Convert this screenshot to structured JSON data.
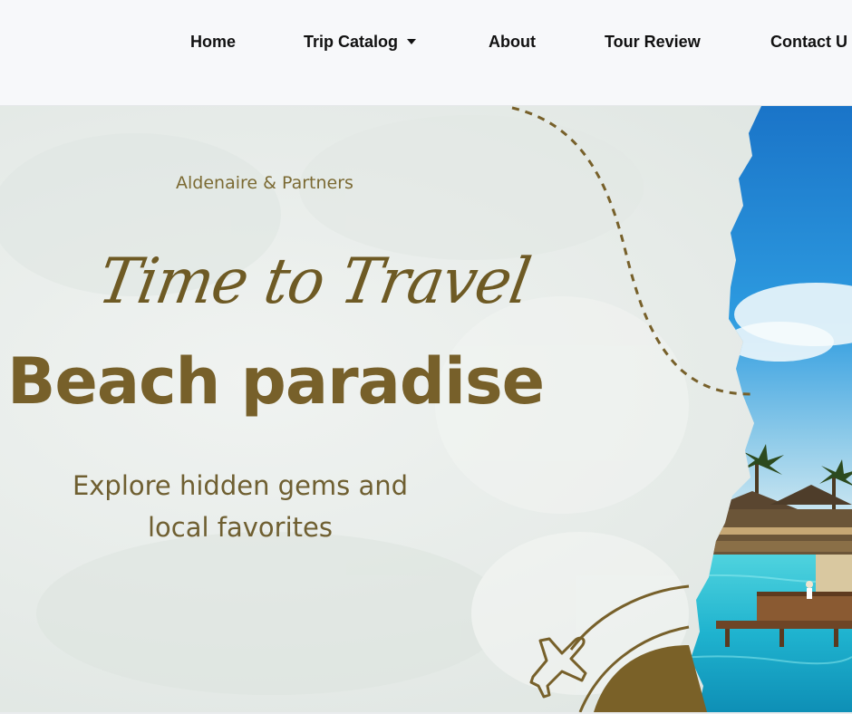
{
  "nav": {
    "items": [
      {
        "label": "Home"
      },
      {
        "label": "Trip Catalog"
      },
      {
        "label": "About"
      },
      {
        "label": "Tour Review"
      },
      {
        "label": "Contact U"
      }
    ]
  },
  "hero": {
    "brand": "Aldenaire & Partners",
    "script_title": "Time to Travel",
    "headline": "Beach paradise",
    "subtitle_line1": "Explore hidden gems and",
    "subtitle_line2": "local favorites"
  },
  "colors": {
    "accent_gold": "#77602a",
    "background": "#e6ebe8",
    "sea": "#29b8d0"
  }
}
